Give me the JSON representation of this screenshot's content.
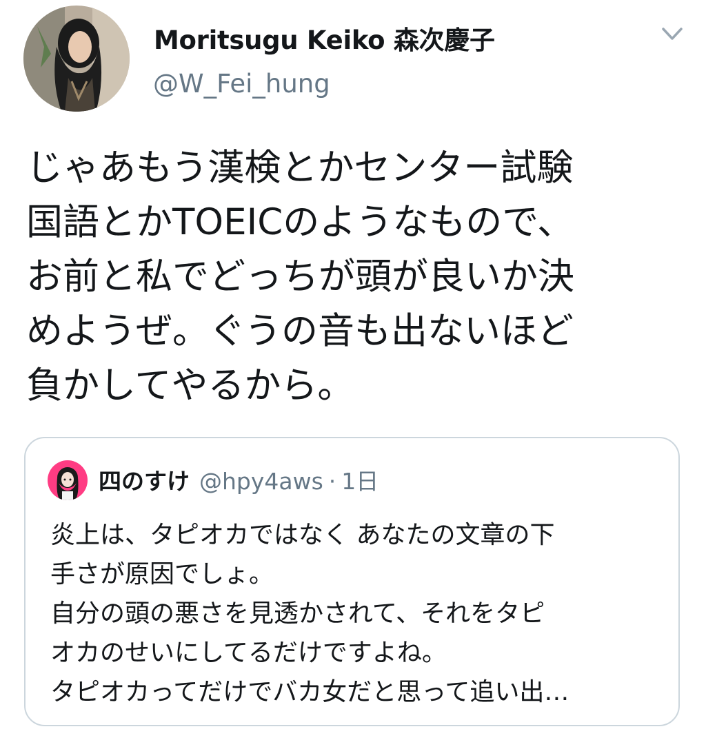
{
  "tweet": {
    "display_name": "Moritsugu Keiko 森次慶子",
    "handle": "@W_Fei_hung",
    "avatar_icon": "profile-photo",
    "menu_icon": "chevron-down-icon",
    "text": "じゃあもう漢検とかセンター試験\n国語とかTOEICのようなもので、\nお前と私でどっちが頭が良いか決\nめようぜ。ぐうの音も出ないほど\n負かしてやるから。"
  },
  "quote": {
    "display_name": "四のすけ",
    "handle": "@hpy4aws",
    "separator": "·",
    "time": "1日",
    "avatar_icon": "profile-illustration",
    "text": "炎上は、タピオカではなく あなたの文章の下\n手さが原因でしょ。\n自分の頭の悪さを見透かされて、それをタピ\nオカのせいにしてるだけですよね。\nタピオカってだけでバカ女だと思って追い出…"
  },
  "colors": {
    "text_primary": "#14171a",
    "text_secondary": "#657786",
    "border": "#ccd6dd",
    "background": "#ffffff"
  }
}
